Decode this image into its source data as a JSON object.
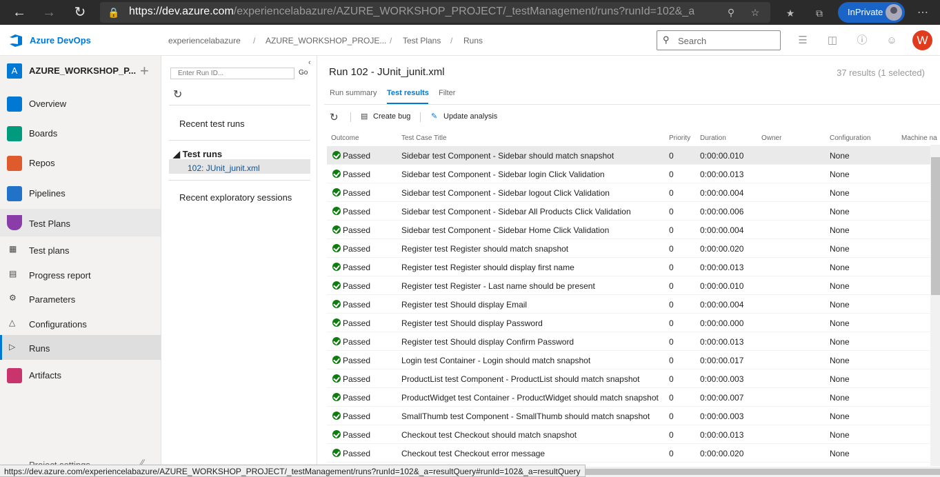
{
  "browser": {
    "url_host": "https://dev.azure.com",
    "url_path": "/experiencelabazure/AZURE_WORKSHOP_PROJECT/_testManagement/runs?runId=102&_a=resul...",
    "inprivate_label": "InPrivate",
    "back_icon": "arrow-left-icon",
    "forward_icon": "arrow-right-icon",
    "refresh_icon": "refresh-icon",
    "lock_icon": "lock-icon"
  },
  "header": {
    "brand": "Azure DevOps",
    "breadcrumbs": [
      "experiencelabazure",
      "AZURE_WORKSHOP_PROJE...",
      "Test Plans",
      "Runs"
    ],
    "search_placeholder": "Search",
    "user_initial": "W",
    "accent": "#0078d4"
  },
  "sidebar": {
    "project_initial": "A",
    "project_name": "AZURE_WORKSHOP_P...",
    "add_icon": "plus-icon",
    "items": [
      {
        "label": "Overview",
        "color": "#0078d4"
      },
      {
        "label": "Boards",
        "color": "#009b7c"
      },
      {
        "label": "Repos",
        "color": "#e05b2b"
      },
      {
        "label": "Pipelines",
        "color": "#2272c9"
      },
      {
        "label": "Test Plans",
        "color": "#8a3ca8"
      },
      {
        "label": "Test plans"
      },
      {
        "label": "Progress report"
      },
      {
        "label": "Parameters"
      },
      {
        "label": "Configurations"
      },
      {
        "label": "Runs"
      },
      {
        "label": "Artifacts",
        "color": "#c8346b"
      }
    ],
    "settings_label": "Project settings"
  },
  "midpanel": {
    "runid_placeholder": "Enter Run ID...",
    "go_label": "Go",
    "recent_runs": "Recent test runs",
    "tree_header": "Test runs",
    "tree_child": "102: JUnit_junit.xml",
    "recent_exploratory": "Recent exploratory sessions"
  },
  "content": {
    "title": "Run 102 - JUnit_junit.xml",
    "results_count": "37 results (1 selected)",
    "tabs": [
      "Run summary",
      "Test results",
      "Filter"
    ],
    "toolbar": {
      "create_bug": "Create bug",
      "update_analysis": "Update analysis"
    },
    "columns": [
      "Outcome",
      "Test Case Title",
      "Priority",
      "Duration",
      "Owner",
      "Configuration",
      "Machine na"
    ],
    "rows": [
      {
        "outcome": "Passed",
        "title": "Sidebar test Component - Sidebar should match snapshot",
        "priority": "0",
        "duration": "0:00:00.010",
        "config": "None"
      },
      {
        "outcome": "Passed",
        "title": "Sidebar test Component - Sidebar login Click Validation",
        "priority": "0",
        "duration": "0:00:00.013",
        "config": "None"
      },
      {
        "outcome": "Passed",
        "title": "Sidebar test Component - Sidebar logout Click Validation",
        "priority": "0",
        "duration": "0:00:00.004",
        "config": "None"
      },
      {
        "outcome": "Passed",
        "title": "Sidebar test Component - Sidebar All Products Click Validation",
        "priority": "0",
        "duration": "0:00:00.006",
        "config": "None"
      },
      {
        "outcome": "Passed",
        "title": "Sidebar test Component - Sidebar Home Click Validation",
        "priority": "0",
        "duration": "0:00:00.004",
        "config": "None"
      },
      {
        "outcome": "Passed",
        "title": "Register test Register should match snapshot",
        "priority": "0",
        "duration": "0:00:00.020",
        "config": "None"
      },
      {
        "outcome": "Passed",
        "title": "Register test Register should display first name",
        "priority": "0",
        "duration": "0:00:00.013",
        "config": "None"
      },
      {
        "outcome": "Passed",
        "title": "Register test Register - Last name should be present",
        "priority": "0",
        "duration": "0:00:00.010",
        "config": "None"
      },
      {
        "outcome": "Passed",
        "title": "Register test Should display Email",
        "priority": "0",
        "duration": "0:00:00.004",
        "config": "None"
      },
      {
        "outcome": "Passed",
        "title": "Register test Should display Password",
        "priority": "0",
        "duration": "0:00:00.000",
        "config": "None"
      },
      {
        "outcome": "Passed",
        "title": "Register test Should display Confirm Password",
        "priority": "0",
        "duration": "0:00:00.013",
        "config": "None"
      },
      {
        "outcome": "Passed",
        "title": "Login test Container - Login should match snapshot",
        "priority": "0",
        "duration": "0:00:00.017",
        "config": "None"
      },
      {
        "outcome": "Passed",
        "title": "ProductList test Component - ProductList should match snapshot",
        "priority": "0",
        "duration": "0:00:00.003",
        "config": "None"
      },
      {
        "outcome": "Passed",
        "title": "ProductWidget test Container - ProductWidget should match snapshot",
        "priority": "0",
        "duration": "0:00:00.007",
        "config": "None"
      },
      {
        "outcome": "Passed",
        "title": "SmallThumb test Component - SmallThumb should match snapshot",
        "priority": "0",
        "duration": "0:00:00.003",
        "config": "None"
      },
      {
        "outcome": "Passed",
        "title": "Checkout test Checkout should match snapshot",
        "priority": "0",
        "duration": "0:00:00.013",
        "config": "None"
      },
      {
        "outcome": "Passed",
        "title": "Checkout test Checkout error message",
        "priority": "0",
        "duration": "0:00:00.020",
        "config": "None"
      }
    ],
    "pass_color": "#107c10"
  },
  "status_bar": {
    "url": "https://dev.azure.com/experiencelabazure/AZURE_WORKSHOP_PROJECT/_testManagement/runs?runId=102&_a=resultQuery#runId=102&_a=resultQuery"
  }
}
